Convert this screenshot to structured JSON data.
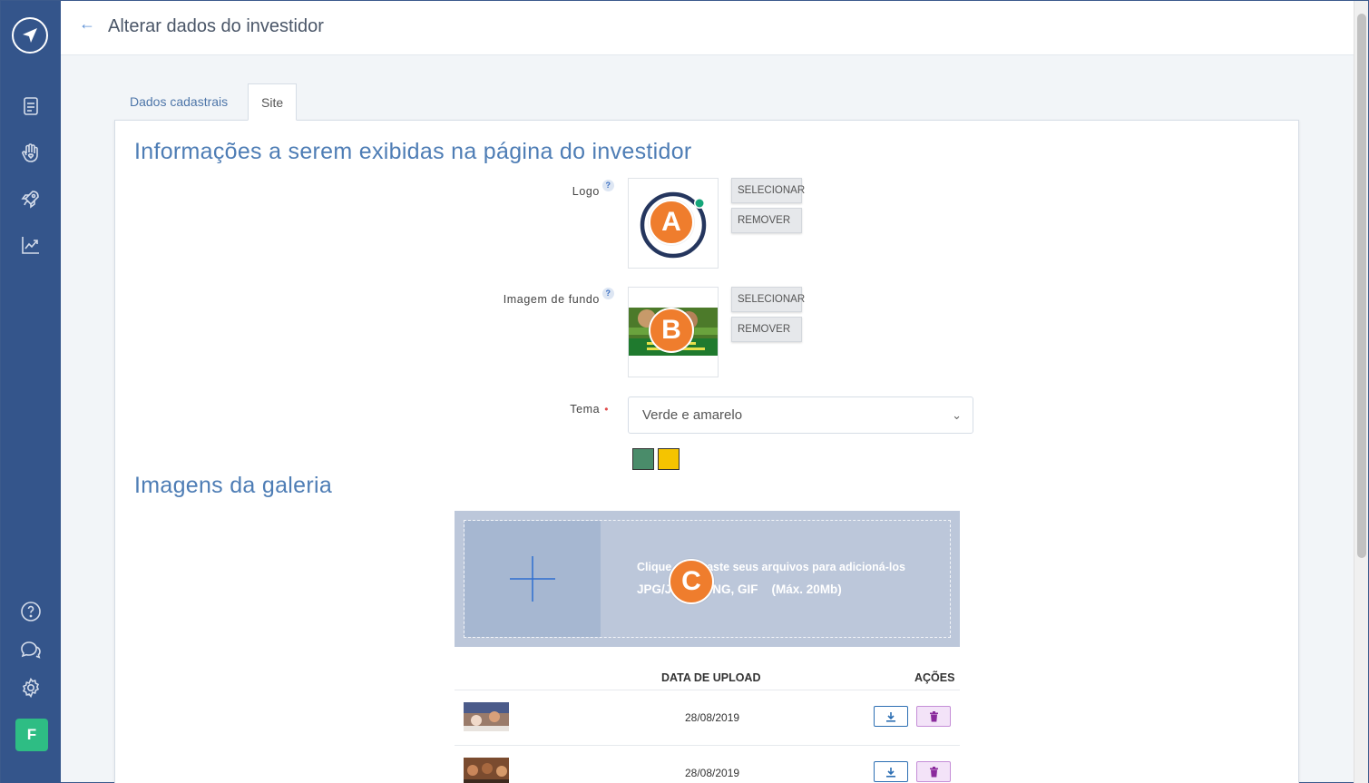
{
  "header": {
    "title": "Alterar dados do investidor"
  },
  "tabs": [
    {
      "label": "Dados cadastrais"
    },
    {
      "label": "Site"
    }
  ],
  "sections": {
    "info_title": "Informações a serem exibidas na página do investidor",
    "gallery_title": "Imagens da galeria"
  },
  "fields": {
    "logo_label": "Logo",
    "background_label": "Imagem de fundo",
    "theme_label": "Tema",
    "help_mark": "?",
    "required_mark": "•"
  },
  "buttons": {
    "select": "SELECIONAR",
    "remove": "REMOVER"
  },
  "theme": {
    "selected": "Verde e amarelo",
    "colors": [
      "#4a8c6a",
      "#f5c400"
    ]
  },
  "badges": {
    "a": "A",
    "b": "B",
    "c": "C"
  },
  "upload": {
    "line1": "Clique ou arraste seus arquivos para adicioná-los",
    "line2": "JPG/JPEG, PNG, GIF    (Máx. 20Mb)"
  },
  "table": {
    "headers": {
      "date": "DATA DE UPLOAD",
      "actions": "AÇÕES"
    },
    "rows": [
      {
        "date": "28/08/2019"
      },
      {
        "date": "28/08/2019"
      }
    ]
  },
  "sidebar": {
    "avatar_letter": "F",
    "icons": [
      "document-icon",
      "hand-heart-icon",
      "rocket-icon",
      "chart-icon",
      "help-icon",
      "chat-icon",
      "settings-icon"
    ]
  },
  "colors": {
    "sidebar": "#34558b",
    "accent": "#4e7db5",
    "badge": "#ef7d2d",
    "avatar": "#2ebd84"
  }
}
